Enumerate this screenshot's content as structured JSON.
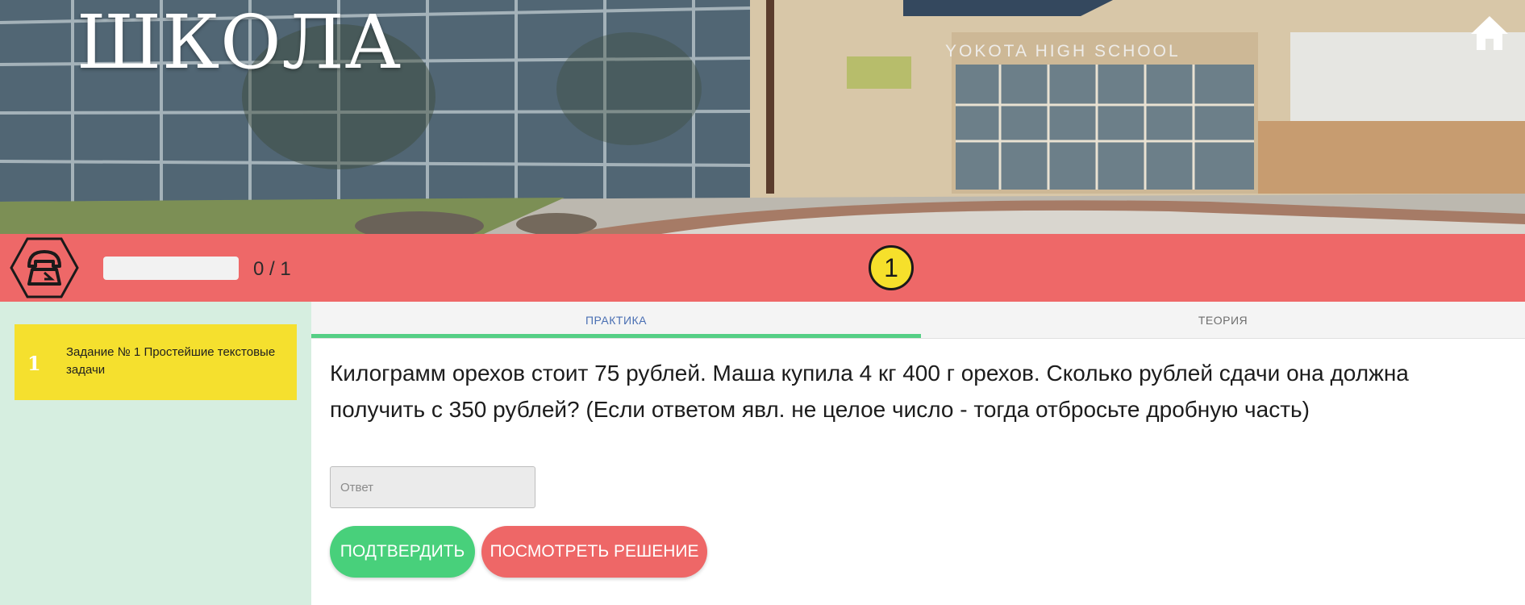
{
  "header": {
    "title": "ШКОЛА",
    "banner_sign": "YOKOTA HIGH SCHOOL",
    "home_icon": "home-icon"
  },
  "statusbar": {
    "logo_icon": "phone-hexagon-logo-icon",
    "progress_fraction": 0,
    "score": "0 / 1",
    "current_task_number": "1",
    "colors": {
      "bar": "#ee6868",
      "badge": "#f6e02b"
    }
  },
  "sidebar": {
    "items": [
      {
        "number": "1",
        "label": "Задание № 1 Простейшие текстовые задачи"
      }
    ],
    "colors": {
      "background": "#d6eee0",
      "active_item": "#f5e02e"
    }
  },
  "tabs": [
    {
      "label": "ПРАКТИКА",
      "active": true
    },
    {
      "label": "ТЕОРИЯ",
      "active": false
    }
  ],
  "main": {
    "question": "Килограмм орехов стоит 75 рублей. Маша купила 4 кг 400 г орехов. Сколько рублей сдачи она должна получить с 350 рублей? (Если ответом явл. не целое число - тогда отбросьте дробную часть)",
    "answer_placeholder": "Ответ",
    "answer_value": "",
    "confirm_label": "ПОДТВЕРДИТЬ",
    "solution_label": "ПОСМОТРЕТЬ РЕШЕНИЕ",
    "colors": {
      "confirm": "#48d07b",
      "solution": "#ee6767"
    }
  }
}
